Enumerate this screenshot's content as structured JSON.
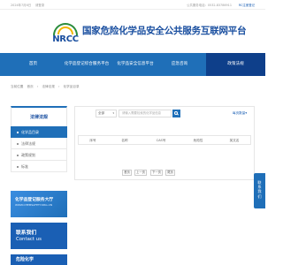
{
  "topbar": {
    "date": "2024年7月6日",
    "login": "请登录",
    "hotline": "公共服务电话：0532-83786911",
    "rc_reg": "RC注册登记"
  },
  "header": {
    "logo_text": "NRCC",
    "site_title": "国家危险化学品安全公共服务互联网平台"
  },
  "nav": {
    "items": [
      {
        "label": "首页"
      },
      {
        "label": "化学品登记综合服务平台"
      },
      {
        "label": "化学品安全信息平台"
      },
      {
        "label": "应急咨询"
      },
      {
        "label": "政策法规"
      }
    ],
    "active_index": 4
  },
  "breadcrumb": [
    "当前位置",
    "首页",
    "法律法规",
    "化学品目录"
  ],
  "sidebar": {
    "title": "法律法规",
    "items": [
      {
        "label": "化学品目录",
        "active": true
      },
      {
        "label": "法律法规",
        "active": false
      },
      {
        "label": "政策规划",
        "active": false
      },
      {
        "label": "标准",
        "active": false
      }
    ]
  },
  "banners": {
    "reg_title": "化学品登记服务大厅",
    "reg_sub": "WWW.CHEMSAFETY.ORG.CN",
    "contact_cn": "联系我们",
    "contact_en": "Contact us",
    "third": "危险化学"
  },
  "search": {
    "select_value": "全部",
    "select_arrow": "▾",
    "placeholder": "请输入需要检索的化学品信息"
  },
  "sort_label": "每页数量▾",
  "table": {
    "headers": [
      "序号",
      "名称",
      "CAS号",
      "危险性",
      "英文名"
    ]
  },
  "pager": {
    "first": "首页",
    "prev": "上一页",
    "next": "下一页",
    "last": "尾页"
  },
  "share": {
    "label": "联系我们"
  },
  "colors": {
    "brand_blue": "#1f6fb8",
    "nav_active": "#0e3f8a",
    "title_blue": "#1a4fa0"
  }
}
